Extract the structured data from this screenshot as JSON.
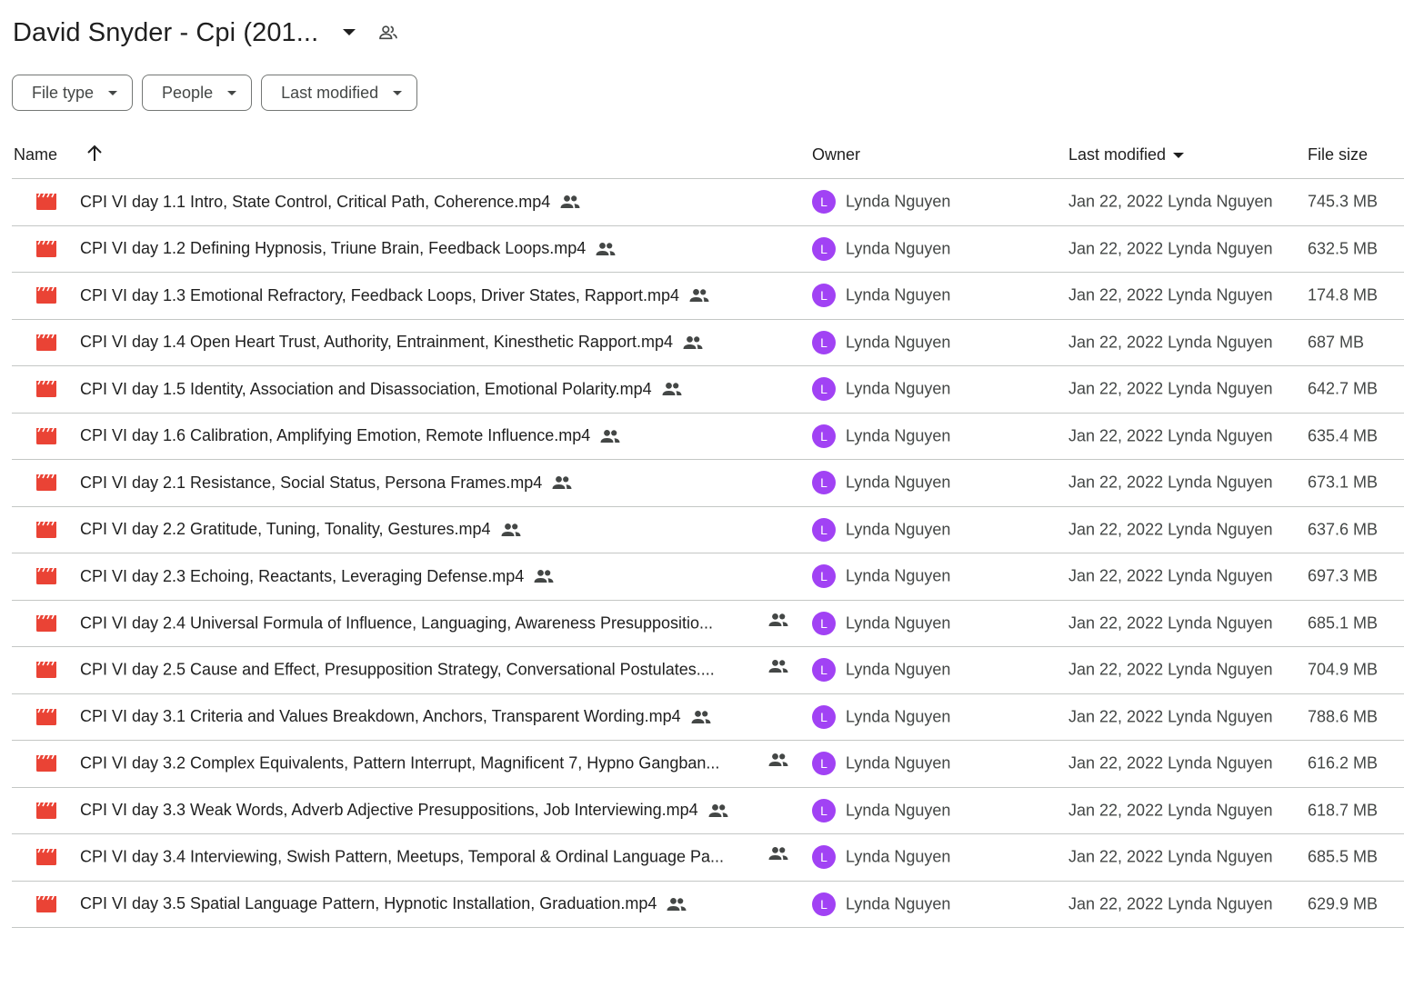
{
  "folder": {
    "title": "David Snyder - Cpi (201..."
  },
  "filters": [
    {
      "label": "File type"
    },
    {
      "label": "People"
    },
    {
      "label": "Last modified"
    }
  ],
  "columns": {
    "name": "Name",
    "owner": "Owner",
    "last_modified": "Last modified",
    "file_size": "File size"
  },
  "files": [
    {
      "name": "CPI VI day 1.1 Intro, State Control, Critical Path, Coherence.mp4",
      "truncated": false,
      "owner": "Lynda Nguyen",
      "avatar": "L",
      "modified": "Jan 22, 2022 Lynda Nguyen",
      "size": "745.3 MB"
    },
    {
      "name": "CPI VI day 1.2 Defining Hypnosis, Triune Brain, Feedback Loops.mp4",
      "truncated": false,
      "owner": "Lynda Nguyen",
      "avatar": "L",
      "modified": "Jan 22, 2022 Lynda Nguyen",
      "size": "632.5 MB"
    },
    {
      "name": "CPI VI day 1.3 Emotional Refractory, Feedback Loops, Driver States, Rapport.mp4",
      "truncated": false,
      "owner": "Lynda Nguyen",
      "avatar": "L",
      "modified": "Jan 22, 2022 Lynda Nguyen",
      "size": "174.8 MB"
    },
    {
      "name": "CPI VI day 1.4 Open Heart Trust, Authority, Entrainment, Kinesthetic Rapport.mp4",
      "truncated": false,
      "owner": "Lynda Nguyen",
      "avatar": "L",
      "modified": "Jan 22, 2022 Lynda Nguyen",
      "size": "687 MB"
    },
    {
      "name": "CPI VI day 1.5 Identity, Association and Disassociation, Emotional Polarity.mp4",
      "truncated": false,
      "owner": "Lynda Nguyen",
      "avatar": "L",
      "modified": "Jan 22, 2022 Lynda Nguyen",
      "size": "642.7 MB"
    },
    {
      "name": "CPI VI day 1.6 Calibration, Amplifying Emotion, Remote Influence.mp4",
      "truncated": false,
      "owner": "Lynda Nguyen",
      "avatar": "L",
      "modified": "Jan 22, 2022 Lynda Nguyen",
      "size": "635.4 MB"
    },
    {
      "name": "CPI VI day 2.1 Resistance, Social Status, Persona Frames.mp4",
      "truncated": false,
      "owner": "Lynda Nguyen",
      "avatar": "L",
      "modified": "Jan 22, 2022 Lynda Nguyen",
      "size": "673.1 MB"
    },
    {
      "name": "CPI VI day 2.2 Gratitude, Tuning, Tonality, Gestures.mp4",
      "truncated": false,
      "owner": "Lynda Nguyen",
      "avatar": "L",
      "modified": "Jan 22, 2022 Lynda Nguyen",
      "size": "637.6 MB"
    },
    {
      "name": "CPI VI day 2.3 Echoing, Reactants, Leveraging Defense.mp4",
      "truncated": false,
      "owner": "Lynda Nguyen",
      "avatar": "L",
      "modified": "Jan 22, 2022 Lynda Nguyen",
      "size": "697.3 MB"
    },
    {
      "name": "CPI VI day 2.4 Universal Formula of Influence, Languaging, Awareness Presuppositio...",
      "truncated": true,
      "owner": "Lynda Nguyen",
      "avatar": "L",
      "modified": "Jan 22, 2022 Lynda Nguyen",
      "size": "685.1 MB"
    },
    {
      "name": "CPI VI day 2.5 Cause and Effect, Presupposition Strategy, Conversational Postulates....",
      "truncated": true,
      "owner": "Lynda Nguyen",
      "avatar": "L",
      "modified": "Jan 22, 2022 Lynda Nguyen",
      "size": "704.9 MB"
    },
    {
      "name": "CPI VI day 3.1 Criteria and Values Breakdown, Anchors, Transparent Wording.mp4",
      "truncated": false,
      "owner": "Lynda Nguyen",
      "avatar": "L",
      "modified": "Jan 22, 2022 Lynda Nguyen",
      "size": "788.6 MB"
    },
    {
      "name": "CPI VI day 3.2 Complex Equivalents, Pattern Interrupt, Magnificent 7, Hypno Gangban...",
      "truncated": true,
      "owner": "Lynda Nguyen",
      "avatar": "L",
      "modified": "Jan 22, 2022 Lynda Nguyen",
      "size": "616.2 MB"
    },
    {
      "name": "CPI VI day 3.3 Weak Words, Adverb Adjective Presuppositions, Job Interviewing.mp4",
      "truncated": false,
      "owner": "Lynda Nguyen",
      "avatar": "L",
      "modified": "Jan 22, 2022 Lynda Nguyen",
      "size": "618.7 MB"
    },
    {
      "name": "CPI VI day 3.4 Interviewing, Swish Pattern, Meetups, Temporal & Ordinal Language Pa...",
      "truncated": true,
      "owner": "Lynda Nguyen",
      "avatar": "L",
      "modified": "Jan 22, 2022 Lynda Nguyen",
      "size": "685.5 MB"
    },
    {
      "name": "CPI VI day 3.5 Spatial Language Pattern, Hypnotic Installation, Graduation.mp4",
      "truncated": false,
      "owner": "Lynda Nguyen",
      "avatar": "L",
      "modified": "Jan 22, 2022 Lynda Nguyen",
      "size": "629.9 MB"
    }
  ],
  "colors": {
    "accent_avatar": "#a142f4",
    "video_icon": "#ea4335",
    "divider": "#c4c7c5"
  },
  "icons": {
    "file": "video-file-icon",
    "shared": "shared-people-icon",
    "sort": "arrow-up-icon"
  }
}
